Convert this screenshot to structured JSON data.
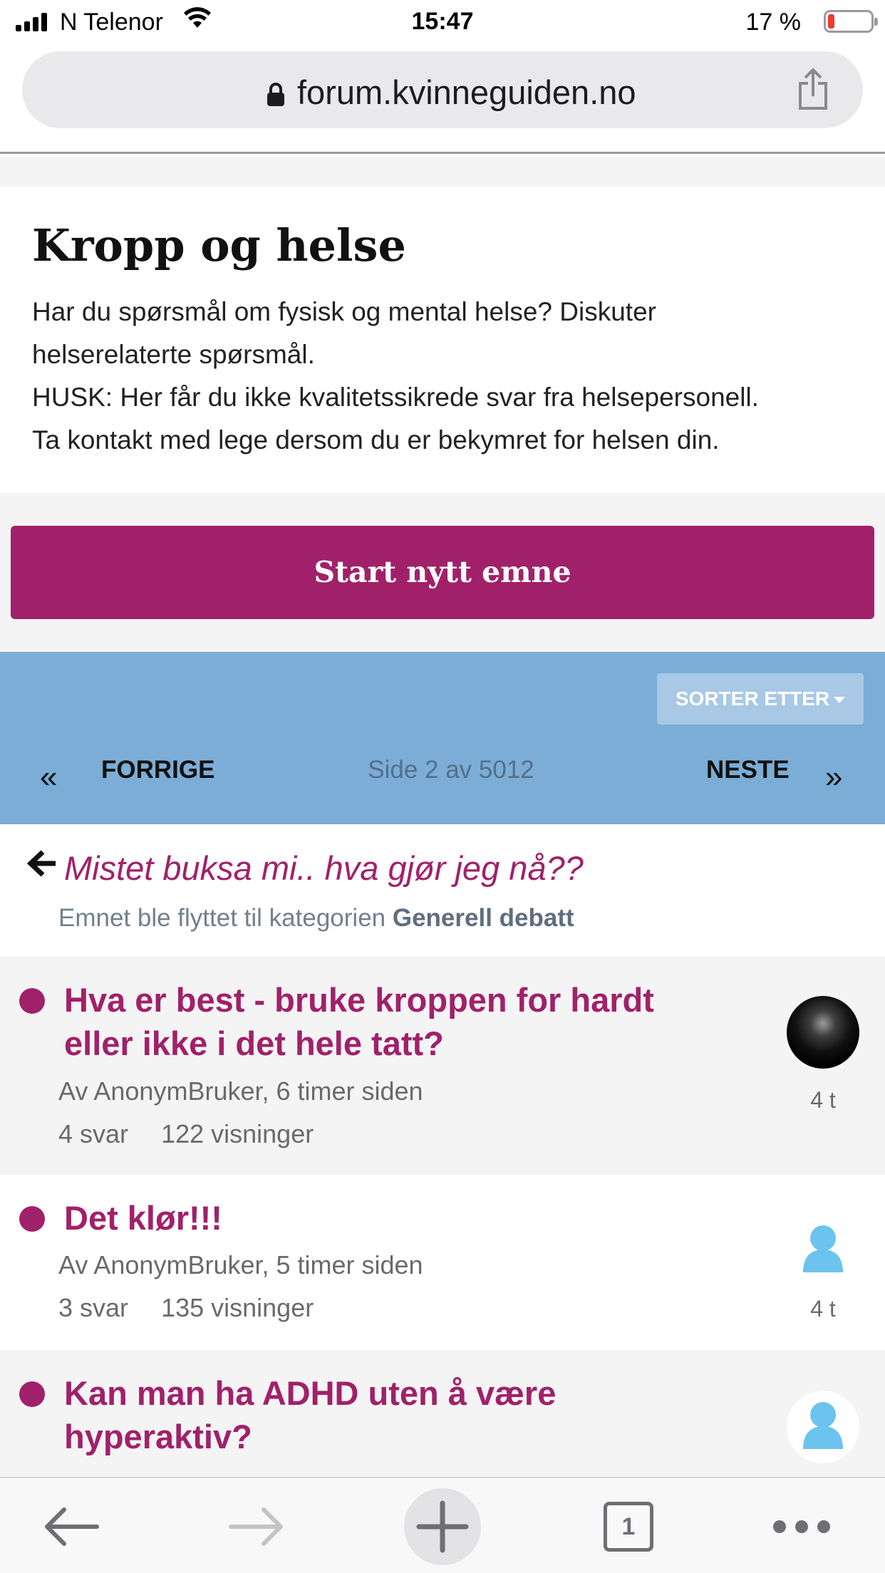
{
  "status_bar": {
    "carrier": "N Telenor",
    "time": "15:47",
    "battery_percent": "17 %",
    "battery_level": 0.17
  },
  "browser": {
    "url": "forum.kvinneguiden.no",
    "tab_count": "1"
  },
  "category": {
    "title": "Kropp og helse",
    "description_lines": [
      "Har du spørsmål om fysisk og mental helse? Diskuter",
      "helserelaterte spørsmål.",
      "HUSK: Her får du ikke kvalitetssikrede svar fra helsepersonell.",
      "Ta kontakt med lege dersom du er bekymret for helsen din."
    ]
  },
  "actions": {
    "start_topic": "Start nytt emne",
    "sort_by": "SORTER ETTER"
  },
  "pagination": {
    "prev_label": "FORRIGE",
    "next_label": "NESTE",
    "page_indicator": "Side 2 av 5012"
  },
  "moved_topic": {
    "title": "Mistet buksa mi.. hva gjør jeg nå??",
    "note_prefix": "Emnet ble flyttet til kategorien",
    "category": "Generell debatt"
  },
  "topics": [
    {
      "title_lines": [
        "Hva er best - bruke kroppen for hardt",
        "eller ikke i det hele tatt?"
      ],
      "meta": "Av AnonymBruker, 6 timer siden",
      "replies": "4 svar",
      "views": "122 visninger",
      "last_post": "4 t",
      "avatar": "photo-avatar"
    },
    {
      "title_lines": [
        "Det klør!!!"
      ],
      "meta": "Av AnonymBruker, 5 timer siden",
      "replies": "3 svar",
      "views": "135 visninger",
      "last_post": "4 t",
      "avatar": "default-user-icon"
    },
    {
      "title_lines": [
        "Kan man ha ADHD uten å være",
        "hyperaktiv?"
      ],
      "meta": "",
      "replies": "",
      "views": "",
      "last_post": "",
      "avatar": "default-user-icon"
    }
  ],
  "colors": {
    "brand": "#a0216a",
    "pager_background": "#7badd6",
    "avatar_blue": "#6cc3ee"
  }
}
